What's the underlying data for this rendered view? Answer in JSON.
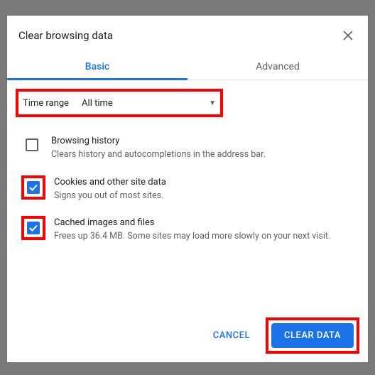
{
  "dialog": {
    "title": "Clear browsing data",
    "tabs": {
      "basic": "Basic",
      "advanced": "Advanced"
    },
    "timeRange": {
      "label": "Time range",
      "value": "All time"
    },
    "options": [
      {
        "title": "Browsing history",
        "desc": "Clears history and autocompletions in the address bar.",
        "checked": false,
        "highlighted": false
      },
      {
        "title": "Cookies and other site data",
        "desc": "Signs you out of most sites.",
        "checked": true,
        "highlighted": true
      },
      {
        "title": "Cached images and files",
        "desc": "Frees up 36.4 MB. Some sites may load more slowly on your next visit.",
        "checked": true,
        "highlighted": true
      }
    ],
    "buttons": {
      "cancel": "CANCEL",
      "clear": "CLEAR DATA"
    }
  }
}
